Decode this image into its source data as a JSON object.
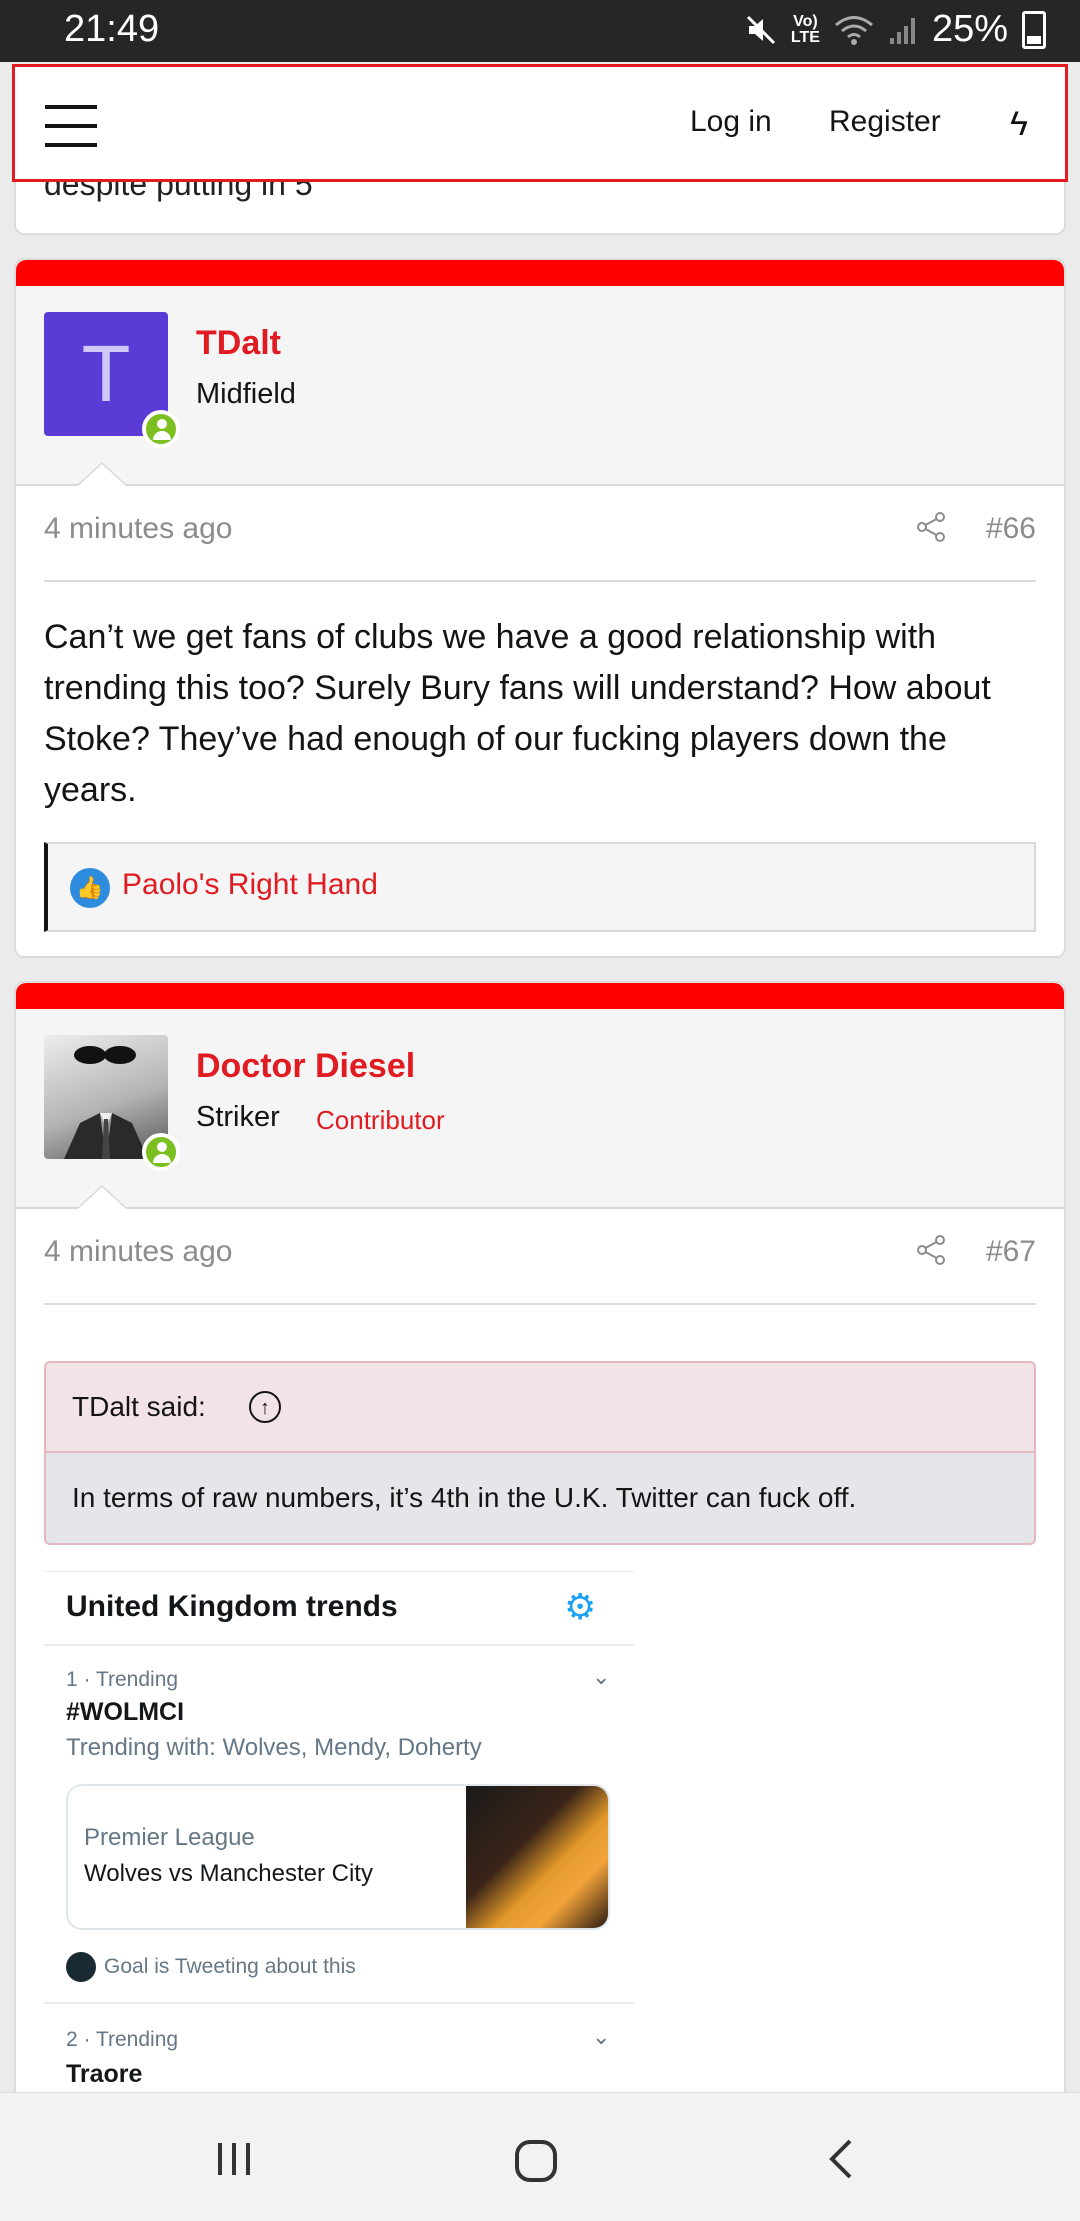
{
  "status": {
    "time": "21:49",
    "volte_top": "Vo)",
    "volte_bottom": "LTE",
    "battery": "25%"
  },
  "topbar": {
    "login": "Log in",
    "register": "Register",
    "bolt": "ϟ"
  },
  "prev_post_text": "despite putting in 5",
  "posts": [
    {
      "avatar_letter": "T",
      "username": "TDalt",
      "user_title": "Midfield",
      "time": "4 minutes ago",
      "number": "#66",
      "body": "Can’t we get fans of clubs we have a good relationship with trending this too? Surely Bury fans will understand? How about Stoke? They’ve had enough of our fucking players down the years.",
      "reaction_user": "Paolo's Right Hand"
    },
    {
      "username": "Doctor Diesel",
      "user_title": "Striker",
      "badge": "Contributor",
      "time": "4 minutes ago",
      "number": "#67",
      "quote_author": "TDalt said:",
      "quote_text": "In terms of raw numbers, it’s 4th in the U.K. Twitter can fuck off."
    }
  ],
  "trends": {
    "title": "United Kingdom trends",
    "items": [
      {
        "rank": "1 · Trending",
        "tag": "#WOLMCI",
        "with": "Trending with: Wolves, Mendy, Doherty",
        "card_league": "Premier League",
        "card_match": "Wolves vs Manchester City",
        "tweeting": "Goal is Tweeting about this"
      },
      {
        "rank": "2 · Trending",
        "tag": "Traore"
      }
    ]
  },
  "icons": {
    "menu": "hamburger-icon",
    "bolt": "lightning-icon",
    "share": "share-icon",
    "like": "thumbs-up-icon",
    "quote_up": "arrow-up-circle-icon",
    "gear": "gear-icon"
  },
  "colors": {
    "accent": "#e11b22",
    "post_bar": "#ff0000",
    "avatar_t": "#5a3bd6",
    "online": "#7cbf20",
    "like": "#2d8cde"
  }
}
